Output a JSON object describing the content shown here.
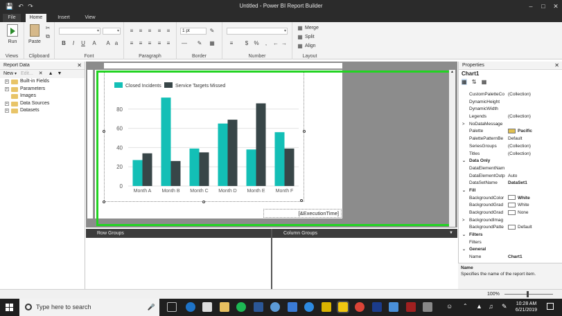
{
  "window": {
    "title": "Untitled - Power BI Report Builder"
  },
  "tabs": {
    "file": "File",
    "home": "Home",
    "insert": "Insert",
    "view": "View"
  },
  "ribbon": {
    "run": "Run",
    "paste": "Paste",
    "groups": {
      "views": "Views",
      "clipboard": "Clipboard",
      "font": "Font",
      "paragraph": "Paragraph",
      "border": "Border",
      "number": "Number",
      "layout": "Layout"
    },
    "border_width": "1 pt",
    "merge": "Merge",
    "split": "Split",
    "align": "Align"
  },
  "report_data": {
    "title": "Report Data",
    "new_label": "New",
    "edit_label": "Edit...",
    "items": [
      "Built-in Fields",
      "Parameters",
      "Images",
      "Data Sources",
      "Datasets"
    ]
  },
  "chart_data": {
    "type": "bar",
    "categories": [
      "Month A",
      "Month B",
      "Month C",
      "Month D",
      "Month E",
      "Month F"
    ],
    "series": [
      {
        "name": "Closed Incidents",
        "values": [
          27,
          92,
          39,
          65,
          38,
          56
        ],
        "color": "#13bfb6"
      },
      {
        "name": "Service Targets Missed",
        "values": [
          34,
          26,
          35,
          69,
          86,
          39
        ],
        "color": "#384648"
      }
    ],
    "ylim": [
      0,
      100
    ],
    "yticks": [
      0,
      20,
      40,
      60,
      80
    ],
    "grid": true,
    "legend": "top-left"
  },
  "report": {
    "exec_time": "[&ExecutionTime]"
  },
  "groups": {
    "row": "Row Groups",
    "column": "Column Groups"
  },
  "properties": {
    "title": "Properties",
    "object": "Chart1",
    "rows": [
      {
        "name": "CustomPaletteCo",
        "value": "(Collection)"
      },
      {
        "name": "DynamicHeight",
        "value": ""
      },
      {
        "name": "DynamicWidth",
        "value": ""
      },
      {
        "name": "Legends",
        "value": "(Collection)"
      },
      {
        "name": "NoDataMessage",
        "value": "",
        "caret": ">"
      },
      {
        "name": "Palette",
        "value": "Pacific",
        "bold": true,
        "swatch": "#e0c050"
      },
      {
        "name": "PalettePatternBe",
        "value": "Default"
      },
      {
        "name": "SeriesGroups",
        "value": "(Collection)"
      },
      {
        "name": "Titles",
        "value": "(Collection)"
      },
      {
        "category": "Data Only"
      },
      {
        "name": "DataElementNam",
        "value": ""
      },
      {
        "name": "DataElementOutp",
        "value": "Auto"
      },
      {
        "name": "DataSetName",
        "value": "DataSet1",
        "bold": true
      },
      {
        "category": "Fill"
      },
      {
        "name": "BackgroundColor",
        "value": "White",
        "bold": true,
        "swatch": "#ffffff"
      },
      {
        "name": "BackgroundGrad",
        "value": "White",
        "swatch": "#ffffff"
      },
      {
        "name": "BackgroundGrad",
        "value": "None",
        "swatch": "#ffffff"
      },
      {
        "name": "BackgroundImag",
        "value": "",
        "caret": ">"
      },
      {
        "name": "BackgroundPatte",
        "value": "Default",
        "swatch": "#ffffff"
      },
      {
        "category": "Filters"
      },
      {
        "name": "Filters",
        "value": ""
      },
      {
        "category": "General"
      },
      {
        "name": "Name",
        "value": "Chart1",
        "bold": true
      }
    ],
    "desc_title": "Name",
    "desc_text": "Specifies the name of the report item."
  },
  "status": {
    "zoom": "100%"
  },
  "taskbar": {
    "search_placeholder": "Type here to search",
    "time": "10:28 AM",
    "date": "6/21/2019"
  }
}
